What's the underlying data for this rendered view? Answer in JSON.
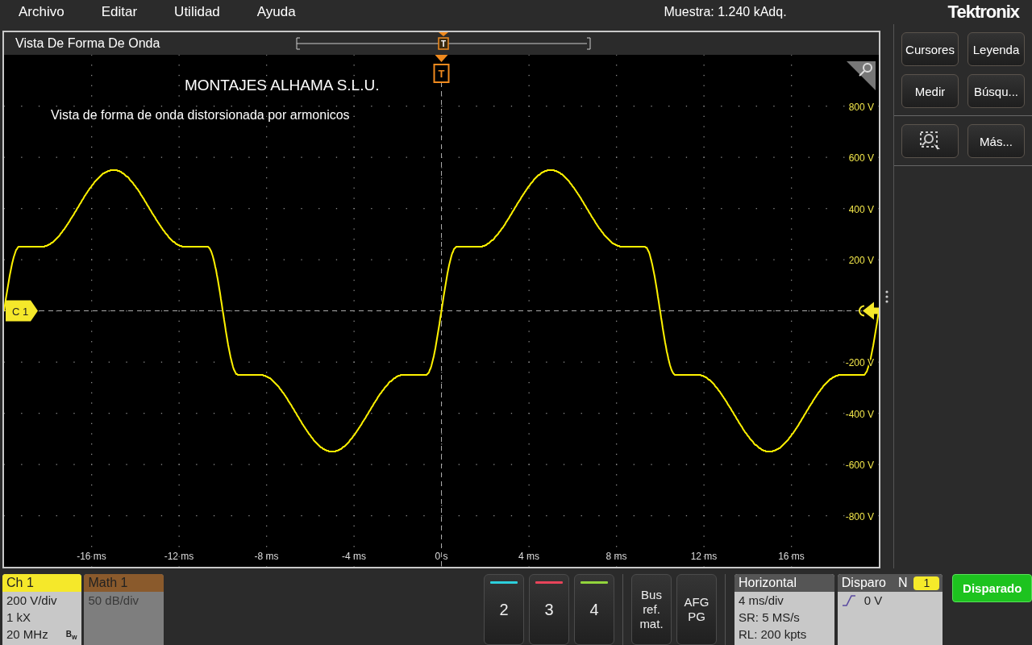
{
  "menu_bar": {
    "items": [
      "Archivo",
      "Editar",
      "Utilidad",
      "Ayuda"
    ],
    "status": "Muestra: 1.240 kAdq.",
    "logo": "Tektronix"
  },
  "waveform_view": {
    "title": "Vista De Forma De Onda",
    "record_marker": "T",
    "trigger_marker": "T",
    "heading": "MONTAJES ALHAMA S.L.U.",
    "caption": "Vista de forma de onda distorsionada por armonicos",
    "channel_marker": "C 1",
    "y_labels": [
      "800 V",
      "600 V",
      "400 V",
      "200 V",
      "-200 V",
      "-400 V",
      "-600 V",
      "-800 V"
    ],
    "x_labels": [
      "-16 ms",
      "-12 ms",
      "-8 ms",
      "-4 ms",
      "0 s",
      "4 ms",
      "8 ms",
      "12 ms",
      "16 ms"
    ]
  },
  "side_buttons": [
    {
      "kind": "text",
      "label": "Cursores"
    },
    {
      "kind": "text",
      "label": "Leyenda"
    },
    {
      "kind": "text",
      "label": "Medir"
    },
    {
      "kind": "text",
      "label": "Búsqu..."
    },
    {
      "kind": "divider"
    },
    {
      "kind": "zoom"
    },
    {
      "kind": "text",
      "label": "Más..."
    },
    {
      "kind": "divider"
    }
  ],
  "channels": [
    {
      "label": "Ch 1",
      "color": "#f5e82a",
      "active": true,
      "lines": [
        "200 V/div",
        "1 kX",
        "20 MHz"
      ],
      "badge": "B$_{w}$"
    },
    {
      "label": "Math 1",
      "color": "#8a5a2c",
      "active": false,
      "lines": [
        "50 dB/div"
      ]
    }
  ],
  "channel_buttons": [
    {
      "label": "2",
      "color": "#2ccfdc"
    },
    {
      "label": "3",
      "color": "#e8445a"
    },
    {
      "label": "4",
      "color": "#92d43c"
    }
  ],
  "tool_buttons": [
    {
      "lines": [
        "Bus",
        "ref.",
        "mat."
      ]
    },
    {
      "lines": [
        "AFG",
        "PG"
      ]
    }
  ],
  "horizontal": {
    "title": "Horizontal",
    "lines": [
      "4 ms/div",
      "SR: 5 MS/s",
      "RL: 200 kpts"
    ]
  },
  "trigger": {
    "title": "Disparo",
    "mode": "N",
    "badge": "1",
    "reading": "0 V"
  },
  "status_button": "Disparado"
}
